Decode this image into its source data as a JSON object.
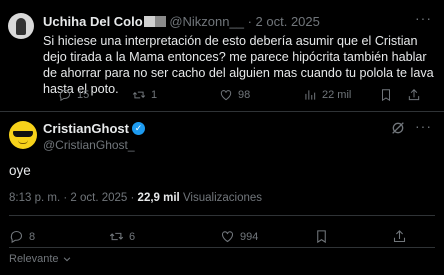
{
  "reply": {
    "author_name": "Uchiha Del Colo",
    "author_handle": "@Nikzonn__",
    "separator": "·",
    "date": "2 oct. 2025",
    "more_label": "···",
    "text": "Si hiciese una interpretación de esto debería asumir que el Cristian dejo tirada a la Mama entonces? me parece hipócrita también hablar de ahorrar para no ser cacho del alguien mas cuando tu polola te lava hasta el poto.",
    "stats": {
      "replies": "15",
      "reposts": "1",
      "likes": "98",
      "views": "22 mil"
    }
  },
  "tweet": {
    "author_name": "CristianGhost",
    "author_handle": "@CristianGhost_",
    "more_label": "···",
    "text": "oye",
    "time": "8:13 p. m.",
    "separator": "·",
    "date": "2 oct. 2025",
    "views_count": "22,9 mil",
    "views_label": "Visualizaciones",
    "stats": {
      "replies": "8",
      "reposts": "6",
      "likes": "994"
    }
  },
  "sort": {
    "label": "Relevante"
  },
  "colors": {
    "background": "#000000",
    "text": "#e7e9ea",
    "muted": "#71767b",
    "verified": "#1d9bf0",
    "divider": "#2f3336"
  }
}
